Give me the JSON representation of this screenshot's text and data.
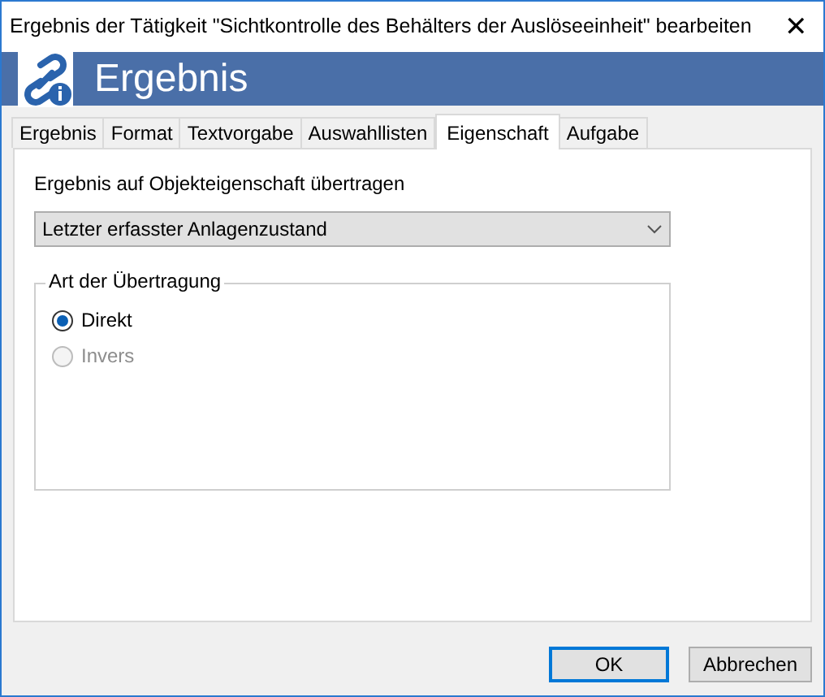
{
  "window": {
    "title": "Ergebnis der Tätigkeit \"Sichtkontrolle des Behälters der Auslöseeinheit\" bearbeiten",
    "close": "✕"
  },
  "banner": {
    "title": "Ergebnis"
  },
  "tabs": [
    {
      "label": "Ergebnis",
      "selected": false
    },
    {
      "label": "Format",
      "selected": false
    },
    {
      "label": "Textvorgabe",
      "selected": false
    },
    {
      "label": "Auswahllisten",
      "selected": false
    },
    {
      "label": "Eigenschaft",
      "selected": true
    },
    {
      "label": "Aufgabe",
      "selected": false
    }
  ],
  "property": {
    "label": "Ergebnis auf Objekteigenschaft übertragen",
    "value": "Letzter erfasster Anlagenzustand"
  },
  "transfer_group": {
    "title": "Art der Übertragung",
    "options": [
      {
        "label": "Direkt",
        "selected": true,
        "disabled": false
      },
      {
        "label": "Invers",
        "selected": false,
        "disabled": true
      }
    ]
  },
  "buttons": [
    {
      "label": "OK",
      "default": true
    },
    {
      "label": "Abbrechen",
      "default": false
    }
  ]
}
